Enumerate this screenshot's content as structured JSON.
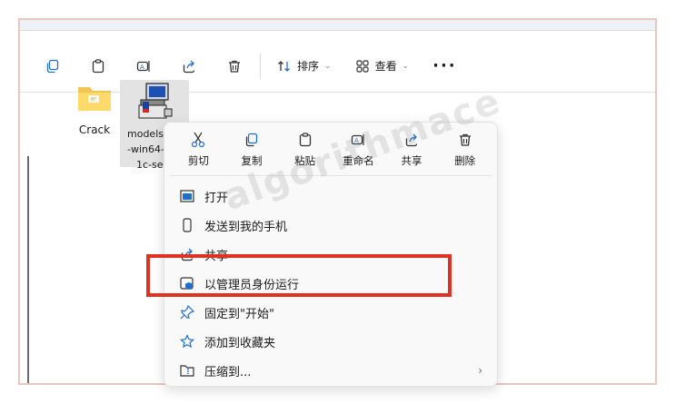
{
  "toolbar": {
    "icons": [
      "copy-icon",
      "paste-icon",
      "rename-icon",
      "share-icon",
      "delete-icon"
    ],
    "sort_label": "排序",
    "view_label": "查看",
    "more_label": "···"
  },
  "files": [
    {
      "name": "Crack",
      "icon": "folder-icon"
    },
    {
      "name_lines": [
        "models",
        "-win64-",
        "1c-se"
      ],
      "icon": "installer-icon"
    }
  ],
  "context_menu": {
    "quick_actions": [
      {
        "label": "剪切",
        "icon": "cut-icon"
      },
      {
        "label": "复制",
        "icon": "copy-icon"
      },
      {
        "label": "粘贴",
        "icon": "paste-icon"
      },
      {
        "label": "重命名",
        "icon": "rename-icon"
      },
      {
        "label": "共享",
        "icon": "share-icon"
      },
      {
        "label": "删除",
        "icon": "delete-icon"
      }
    ],
    "items": [
      {
        "label": "打开",
        "icon": "open-icon"
      },
      {
        "label": "发送到我的手机",
        "icon": "phone-icon"
      },
      {
        "label": "共享",
        "icon": "share-icon"
      },
      {
        "label": "以管理员身份运行",
        "icon": "shield-icon"
      },
      {
        "label": "固定到\"开始\"",
        "icon": "pin-icon"
      },
      {
        "label": "添加到收藏夹",
        "icon": "star-icon"
      },
      {
        "label": "压缩到...",
        "icon": "zip-icon",
        "arrow": "›"
      }
    ]
  },
  "watermark": "algorithmace",
  "colors": {
    "highlight": "#e03223",
    "frame": "#e9c6be",
    "shield": "#1f6fd1"
  }
}
